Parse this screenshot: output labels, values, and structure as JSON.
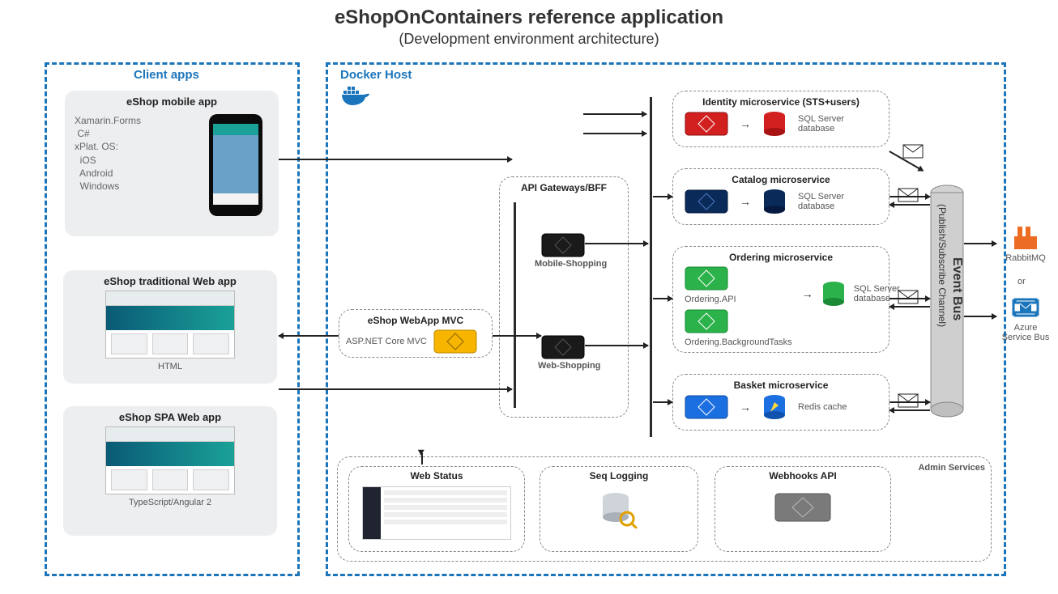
{
  "header": {
    "title": "eShopOnContainers reference application",
    "subtitle": "(Development environment architecture)"
  },
  "clientSection": {
    "label": "Client apps",
    "mobile": {
      "title": "eShop mobile app",
      "tech": "Xamarin.Forms\n C#\nxPlat. OS:\n  iOS\n  Android\n  Windows"
    },
    "webTraditional": {
      "title": "eShop traditional Web app",
      "caption": "HTML"
    },
    "webSpa": {
      "title": "eShop SPA Web app",
      "caption": "TypeScript/Angular 2"
    }
  },
  "dockerSection": {
    "label": "Docker Host",
    "apiGateways": {
      "title": "API Gateways/BFF",
      "mobile": "Mobile-Shopping",
      "web": "Web-Shopping"
    },
    "webappMvc": {
      "title": "eShop WebApp MVC",
      "tech": "ASP.NET Core MVC"
    },
    "microservices": {
      "identity": {
        "title": "Identity microservice (STS+users)",
        "db": "SQL Server database"
      },
      "catalog": {
        "title": "Catalog microservice",
        "db": "SQL Server database"
      },
      "ordering": {
        "title": "Ordering microservice",
        "api": "Ordering.API",
        "bg": "Ordering.BackgroundTasks",
        "db": "SQL Server database"
      },
      "basket": {
        "title": "Basket microservice",
        "db": "Redis cache"
      }
    },
    "admin": {
      "label": "Admin Services",
      "webStatus": "Web Status",
      "seq": "Seq Logging",
      "webhooks": "Webhooks API"
    },
    "eventBus": {
      "title": "Event Bus",
      "channel": "(Publish/Subscribe Channel)"
    },
    "brokers": {
      "rabbit": "RabbitMQ",
      "or": "or",
      "azure": "Azure Service Bus"
    }
  },
  "colors": {
    "identity": "#d21f1f",
    "catalog": "#0a2a5a",
    "ordering": "#2bb24a",
    "basket": "#1b6fe0",
    "mvc": "#f7b500",
    "gateway": "#1a1a1a",
    "webhooks": "#7a7a7a"
  }
}
